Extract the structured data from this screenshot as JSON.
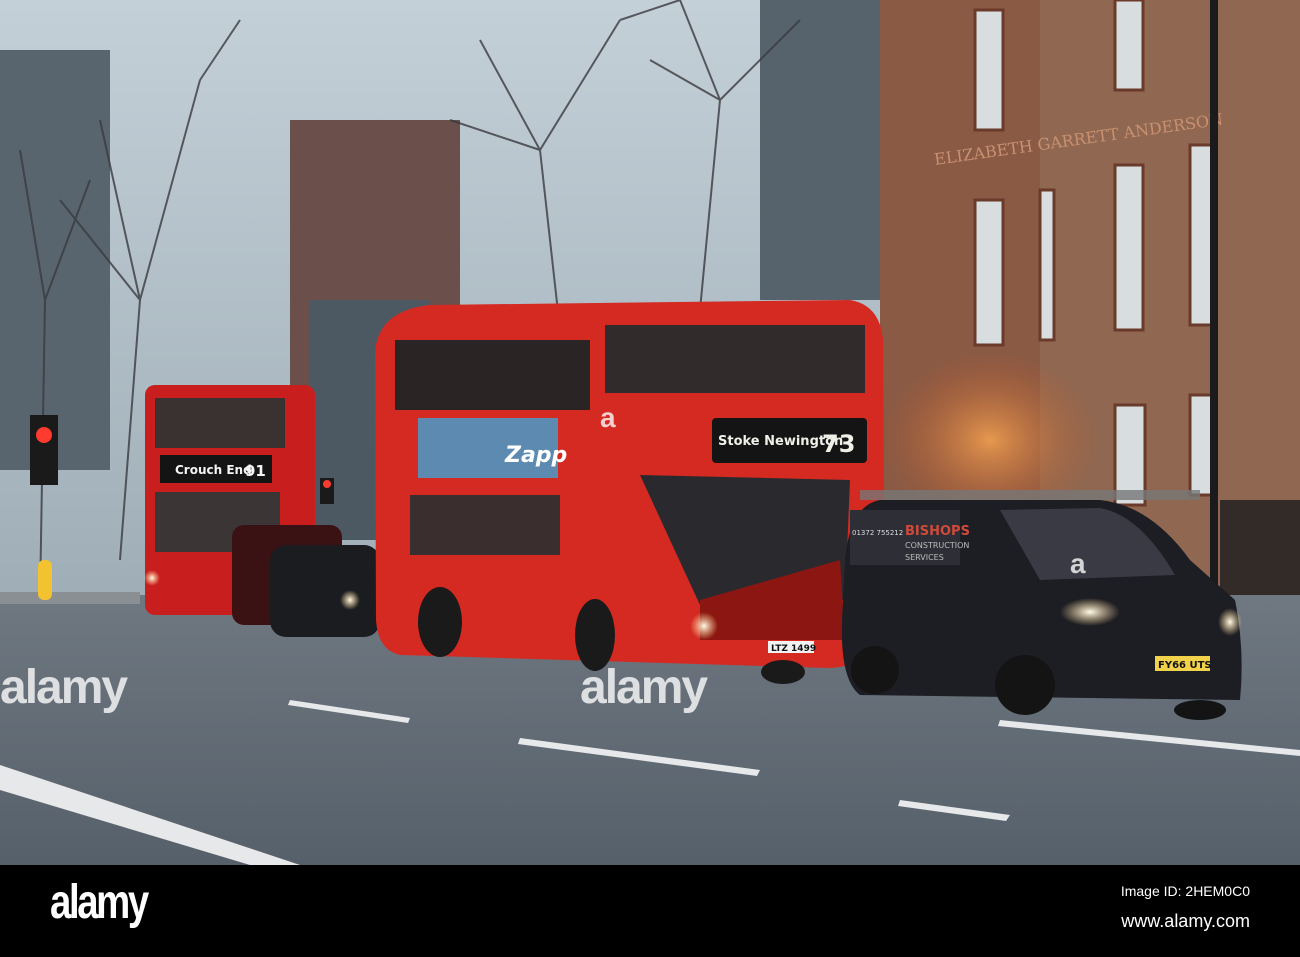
{
  "photo": {
    "building_sign": "ELIZABETH GARRETT ANDERSON",
    "bus_front": {
      "destination": "Stoke Newington",
      "route": "73",
      "plate": "LTZ 1499"
    },
    "bus_rear": {
      "destination": "Crouch End",
      "route": "91"
    },
    "van": {
      "brand": "BISHOPS",
      "subtitle": "CONSTRUCTION",
      "services": "SERVICES",
      "phone": "01372 755212",
      "plate": "FY66 UTS"
    },
    "bus_ad": "Zapp"
  },
  "watermark": {
    "center": "alamy",
    "mark": "a"
  },
  "footer": {
    "logo": "alamy",
    "image_id": "Image ID: 2HEM0C0",
    "website": "www.alamy.com"
  }
}
